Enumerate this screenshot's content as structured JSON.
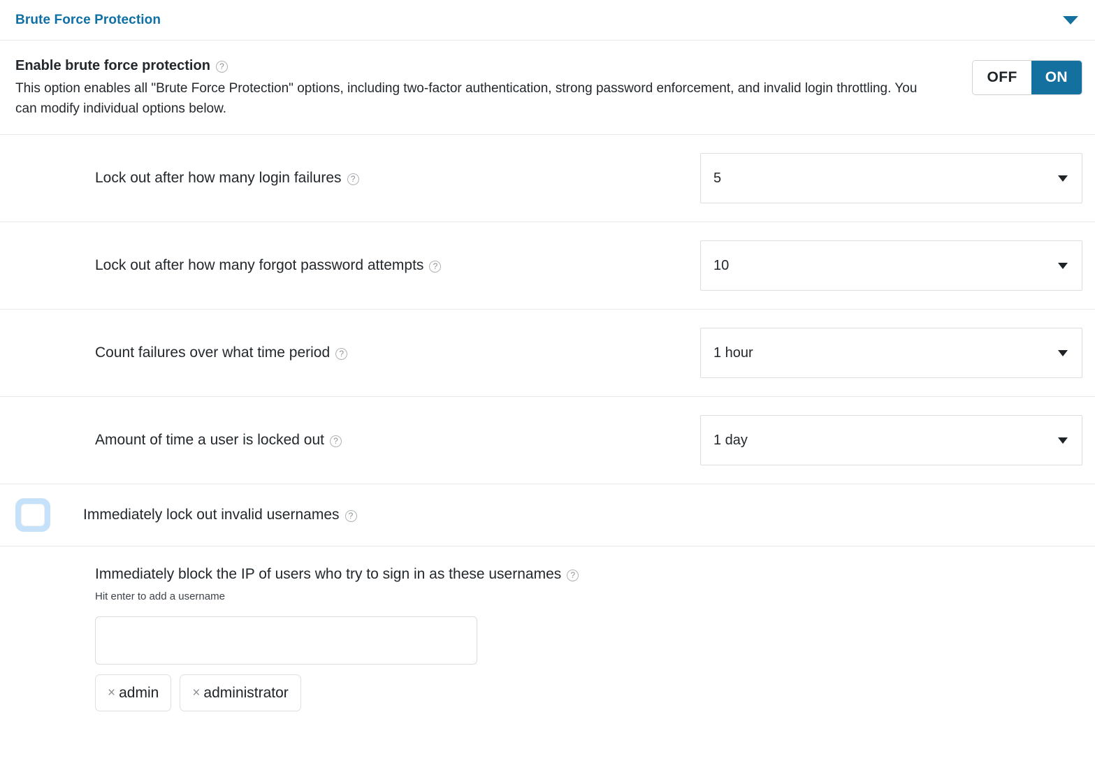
{
  "panel": {
    "title": "Brute Force Protection",
    "collapse_icon": "chevron-down-icon",
    "accent_color": "#0e70a4",
    "toggle_on_color": "#14709f"
  },
  "enable": {
    "title": "Enable brute force protection",
    "help_icon": "?",
    "description": "This option enables all \"Brute Force Protection\" options, including two-factor authentication, strong password enforcement, and invalid login throttling. You can modify individual options below.",
    "toggle": {
      "off_label": "OFF",
      "on_label": "ON",
      "selected": "ON"
    }
  },
  "settings": [
    {
      "label": "Lock out after how many login failures",
      "value": "5",
      "help_icon": "?"
    },
    {
      "label": "Lock out after how many forgot password attempts",
      "value": "10",
      "help_icon": "?"
    },
    {
      "label": "Count failures over what time period",
      "value": "1 hour",
      "help_icon": "?"
    },
    {
      "label": "Amount of time a user is locked out",
      "value": "1 day",
      "help_icon": "?"
    }
  ],
  "checkbox_setting": {
    "label": "Immediately lock out invalid usernames",
    "checked": false,
    "help_icon": "?"
  },
  "usernames": {
    "label": "Immediately block the IP of users who try to sign in as these usernames",
    "help_icon": "?",
    "hint": "Hit enter to add a username",
    "input_value": "",
    "input_placeholder": "",
    "tags": [
      {
        "remove_icon": "×",
        "label": "admin"
      },
      {
        "remove_icon": "×",
        "label": "administrator"
      }
    ]
  }
}
